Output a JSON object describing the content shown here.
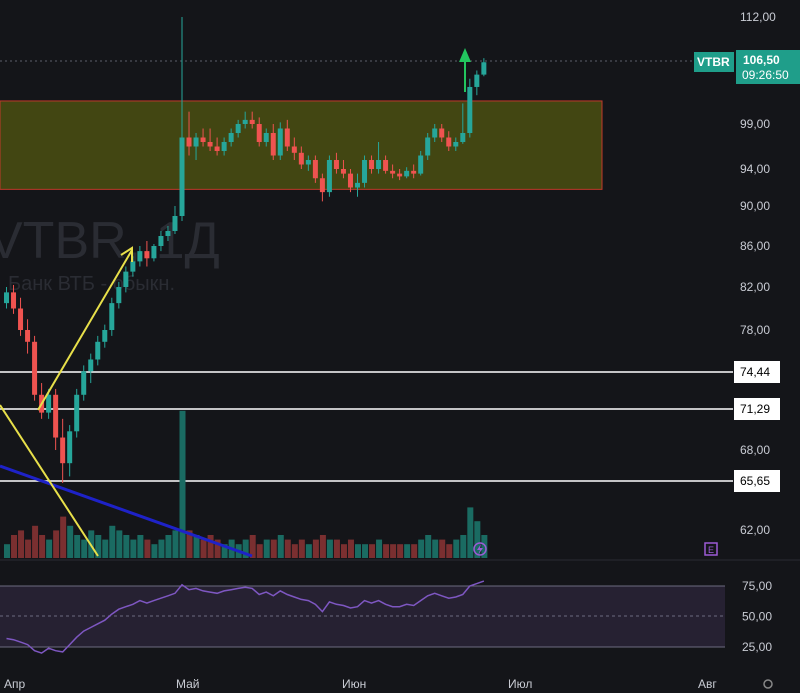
{
  "chart_data": {
    "type": "candlestick",
    "symbol": "VTBR",
    "watermark_ticker": "VTBR, 1Д",
    "watermark_name": "Банк ВТБ - обыкн.",
    "last_price_label": "106,50",
    "last_time_label": "09:26:50",
    "y_ticks": [
      "112,00",
      "99,00",
      "94,00",
      "90,00",
      "86,00",
      "82,00",
      "78,00",
      "68,00",
      "62,00"
    ],
    "rsi_ticks": [
      "75,00",
      "50,00",
      "25,00"
    ],
    "x_ticks": [
      "Апр",
      "Май",
      "Июн",
      "Июл",
      "Авг"
    ],
    "levels": [
      {
        "label": "74,44",
        "value": 74.44
      },
      {
        "label": "71,29",
        "value": 71.29
      },
      {
        "label": "65,65",
        "value": 65.65
      }
    ],
    "zone": {
      "low": 91.8,
      "high": 101.8
    },
    "colors": {
      "up": "#26a69a",
      "down": "#ef5350",
      "zone_fill": "#4a4f12",
      "zone_border": "#c0392b",
      "rsi_line": "#7e57c2",
      "trendline": "#1e22c8",
      "arrow": "#e8e04a",
      "tag": "#1f9e8a",
      "target_arrow": "#22c55e"
    },
    "candles": [
      [
        80.5,
        82.0,
        80.0,
        81.5
      ],
      [
        81.5,
        82.2,
        79.5,
        80.0
      ],
      [
        80.0,
        81.0,
        77.5,
        78.0
      ],
      [
        78.0,
        79.0,
        76.0,
        77.0
      ],
      [
        77.0,
        77.5,
        72.0,
        72.5
      ],
      [
        72.5,
        73.5,
        70.5,
        71.0
      ],
      [
        71.0,
        73.0,
        70.5,
        72.5
      ],
      [
        72.5,
        73.0,
        68.0,
        69.0
      ],
      [
        69.0,
        70.5,
        65.5,
        67.0
      ],
      [
        67.0,
        70.0,
        66.0,
        69.5
      ],
      [
        69.5,
        73.0,
        69.0,
        72.5
      ],
      [
        72.5,
        75.0,
        72.0,
        74.5
      ],
      [
        74.5,
        76.0,
        73.5,
        75.5
      ],
      [
        75.5,
        77.5,
        75.0,
        77.0
      ],
      [
        77.0,
        78.5,
        76.5,
        78.0
      ],
      [
        78.0,
        81.0,
        77.5,
        80.5
      ],
      [
        80.5,
        82.5,
        80.0,
        82.0
      ],
      [
        82.0,
        84.0,
        81.5,
        83.5
      ],
      [
        83.5,
        85.0,
        83.0,
        84.5
      ],
      [
        84.5,
        86.0,
        84.0,
        85.5
      ],
      [
        85.5,
        86.5,
        84.0,
        84.8
      ],
      [
        84.8,
        86.2,
        84.5,
        86.0
      ],
      [
        86.0,
        87.5,
        85.5,
        87.0
      ],
      [
        87.0,
        88.0,
        86.5,
        87.5
      ],
      [
        87.5,
        90.0,
        87.2,
        89.0
      ],
      [
        89.0,
        112.0,
        88.5,
        97.5
      ],
      [
        97.5,
        100.5,
        95.5,
        96.5
      ],
      [
        96.5,
        98.0,
        95.0,
        97.5
      ],
      [
        97.5,
        98.5,
        96.5,
        97.0
      ],
      [
        97.0,
        98.5,
        96.0,
        96.5
      ],
      [
        96.5,
        97.5,
        95.5,
        96.0
      ],
      [
        96.0,
        97.5,
        95.5,
        97.0
      ],
      [
        97.0,
        98.5,
        96.5,
        98.0
      ],
      [
        98.0,
        99.5,
        97.5,
        99.0
      ],
      [
        99.0,
        100.5,
        98.5,
        99.5
      ],
      [
        99.5,
        100.5,
        98.5,
        99.0
      ],
      [
        99.0,
        99.8,
        96.5,
        97.0
      ],
      [
        97.0,
        98.5,
        96.5,
        98.0
      ],
      [
        98.0,
        99.0,
        95.0,
        95.5
      ],
      [
        95.5,
        99.2,
        95.0,
        98.5
      ],
      [
        98.5,
        99.5,
        96.0,
        96.5
      ],
      [
        96.5,
        97.5,
        95.0,
        95.8
      ],
      [
        95.8,
        96.5,
        94.0,
        94.5
      ],
      [
        94.5,
        95.5,
        93.8,
        95.0
      ],
      [
        95.0,
        95.5,
        92.5,
        93.0
      ],
      [
        93.0,
        93.5,
        90.5,
        91.5
      ],
      [
        91.5,
        95.5,
        91.0,
        95.0
      ],
      [
        95.0,
        95.8,
        93.5,
        94.0
      ],
      [
        94.0,
        95.0,
        93.0,
        93.5
      ],
      [
        93.5,
        94.0,
        91.5,
        92.0
      ],
      [
        92.0,
        93.5,
        91.0,
        92.5
      ],
      [
        92.5,
        95.5,
        92.0,
        95.0
      ],
      [
        95.0,
        95.5,
        93.5,
        94.0
      ],
      [
        94.0,
        97.0,
        93.5,
        95.0
      ],
      [
        95.0,
        95.5,
        93.5,
        93.8
      ],
      [
        93.8,
        94.5,
        93.0,
        93.5
      ],
      [
        93.5,
        94.0,
        92.8,
        93.2
      ],
      [
        93.2,
        94.2,
        93.0,
        93.8
      ],
      [
        93.8,
        94.5,
        93.0,
        93.5
      ],
      [
        93.5,
        96.0,
        93.3,
        95.5
      ],
      [
        95.5,
        98.0,
        95.0,
        97.5
      ],
      [
        97.5,
        99.0,
        97.0,
        98.5
      ],
      [
        98.5,
        99.0,
        97.0,
        97.5
      ],
      [
        97.5,
        98.2,
        96.0,
        96.5
      ],
      [
        96.5,
        97.5,
        96.0,
        97.0
      ],
      [
        97.0,
        101.5,
        96.8,
        98.0
      ],
      [
        98.0,
        104.5,
        97.5,
        103.5
      ],
      [
        103.5,
        105.5,
        102.5,
        105.0
      ],
      [
        105.0,
        107.0,
        104.8,
        106.5
      ]
    ],
    "volumes": [
      3,
      5,
      6,
      4,
      7,
      5,
      4,
      6,
      9,
      7,
      5,
      4,
      6,
      5,
      4,
      7,
      6,
      5,
      4,
      5,
      4,
      3,
      4,
      5,
      6,
      32,
      6,
      5,
      4,
      5,
      4,
      3,
      4,
      3,
      4,
      5,
      3,
      4,
      4,
      5,
      4,
      3,
      4,
      3,
      4,
      5,
      4,
      4,
      3,
      4,
      3,
      3,
      3,
      4,
      3,
      3,
      3,
      3,
      3,
      4,
      5,
      4,
      4,
      3,
      4,
      5,
      11,
      8,
      5
    ],
    "rsi": [
      32,
      31,
      29,
      27,
      22,
      20,
      24,
      22,
      21,
      27,
      33,
      38,
      41,
      44,
      47,
      52,
      56,
      58,
      60,
      63,
      61,
      63,
      65,
      67,
      69,
      76,
      72,
      73,
      71,
      70,
      69,
      71,
      72,
      73,
      74,
      73,
      68,
      70,
      67,
      71,
      68,
      66,
      64,
      63,
      60,
      54,
      62,
      60,
      59,
      57,
      58,
      63,
      61,
      63,
      60,
      58,
      58,
      60,
      59,
      63,
      67,
      69,
      67,
      65,
      66,
      68,
      75,
      77,
      79
    ]
  }
}
